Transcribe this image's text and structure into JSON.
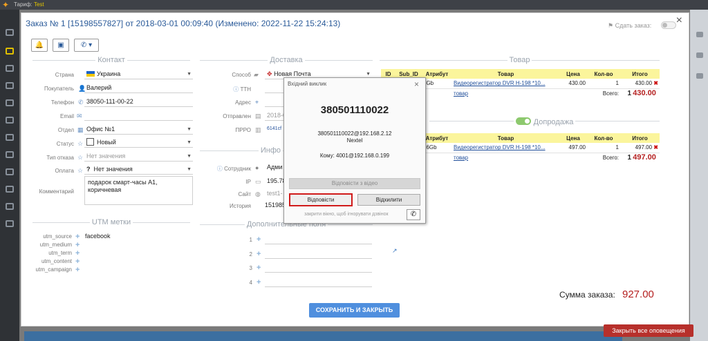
{
  "app": {
    "title_prefix": "Тариф:",
    "title_value": "Test"
  },
  "order": {
    "title": "Заказ № 1 [15198557827] от 2018-03-01 00:09:40 (Изменено: 2022-11-22 15:24:13)",
    "close": "×",
    "sdat_label": "Сдать заказ:"
  },
  "toolbar": {
    "bell_icon": "bell-icon",
    "card_icon": "card-icon",
    "phone_icon": "phone-icon"
  },
  "contact": {
    "section": "Контакт",
    "country": {
      "label": "Страна",
      "value": "Украина"
    },
    "customer": {
      "label": "Покупатель",
      "value": "Валерий"
    },
    "phone": {
      "label": "Телефон",
      "value": "38050-111-00-22"
    },
    "email": {
      "label": "Email",
      "value": ""
    },
    "dept": {
      "label": "Отдел",
      "value": "Офис №1"
    },
    "status": {
      "label": "Статус",
      "value": "Новый"
    },
    "refusal": {
      "label": "Тип отказа",
      "value": "Нет значения"
    },
    "payment": {
      "label": "Оплата",
      "value": "Нет значения"
    },
    "comment": {
      "label": "Комментарий",
      "value": "подарок смарт-часы А1, коричневая"
    }
  },
  "utm": {
    "section": "UTM метки",
    "items": [
      {
        "label": "utm_source",
        "value": "facebook"
      },
      {
        "label": "utm_medium",
        "value": ""
      },
      {
        "label": "utm_term",
        "value": ""
      },
      {
        "label": "utm_content",
        "value": ""
      },
      {
        "label": "utm_campaign",
        "value": ""
      }
    ]
  },
  "delivery": {
    "section": "Доставка",
    "method": {
      "label": "Способ",
      "value": "Новая Почта"
    },
    "ttn": {
      "label": "ТТН",
      "value": ""
    },
    "address": {
      "label": "Адрес",
      "value": ""
    },
    "sent": {
      "label": "Отправлен",
      "value": "2018-0"
    },
    "prro": {
      "label": "ПРРО",
      "value": "6141сf"
    }
  },
  "info": {
    "section": "Инфо",
    "employee": {
      "label": "Сотрудник",
      "value": "Адми"
    },
    "ip": {
      "label": "IP",
      "value": "195.78"
    },
    "site": {
      "label": "Сайт",
      "value": "test1-"
    },
    "history": {
      "label": "История",
      "value": "151985"
    }
  },
  "extra": {
    "section": "Дополнительные поля",
    "nums": [
      "1",
      "2",
      "3",
      "4"
    ]
  },
  "goods": {
    "section": "Товар",
    "headers": [
      "ID",
      "Sub_ID",
      "Атрибут",
      "Товар",
      "Цена",
      "Кол-во",
      "Итого"
    ],
    "row": {
      "attr": "8Gb",
      "product": "Видеорегистратор DVR H-198 *10...",
      "price": "430.00",
      "qty": "1",
      "total": "430.00"
    },
    "add_link": "товар",
    "total_label": "Всего:",
    "total_qty": "1",
    "total_sum": "430.00"
  },
  "upsell": {
    "section": "Допродажа",
    "headers": [
      "Атрибут",
      "Товар",
      "Цена",
      "Кол-во",
      "Итого"
    ],
    "row": {
      "attr": "16Gb",
      "product": "Видеорегистратор DVR H-198 *10...",
      "price": "497.00",
      "qty": "1",
      "total": "497.00"
    },
    "add_link": "товар",
    "total_label": "Всего:",
    "total_qty": "1",
    "total_sum": "497.00"
  },
  "summary": {
    "label": "Сумма заказа:",
    "value": "927.00"
  },
  "save_button": "СОХРАНИТЬ И ЗАКРЫТЬ",
  "call_dialog": {
    "title": "Вхідний виклик",
    "close": "×",
    "number": "380501110022",
    "sip": "380501110022@192.168.2.12",
    "provider": "Nextel",
    "to": "Кому: 4001@192.168.0.199",
    "video_button": "Відповісти з відео",
    "answer_button": "Відповісти",
    "reject_button": "Відхилити",
    "hint": "закрити вікно, щоб ігнорувати дзвінок"
  },
  "notification": "Закрыть все оповещения",
  "colors": {
    "accent": "#2a5a99",
    "total_red": "#b41e1e",
    "highlight": "#fbf59c",
    "save": "#4f8fde",
    "notif": "#b7302b"
  }
}
